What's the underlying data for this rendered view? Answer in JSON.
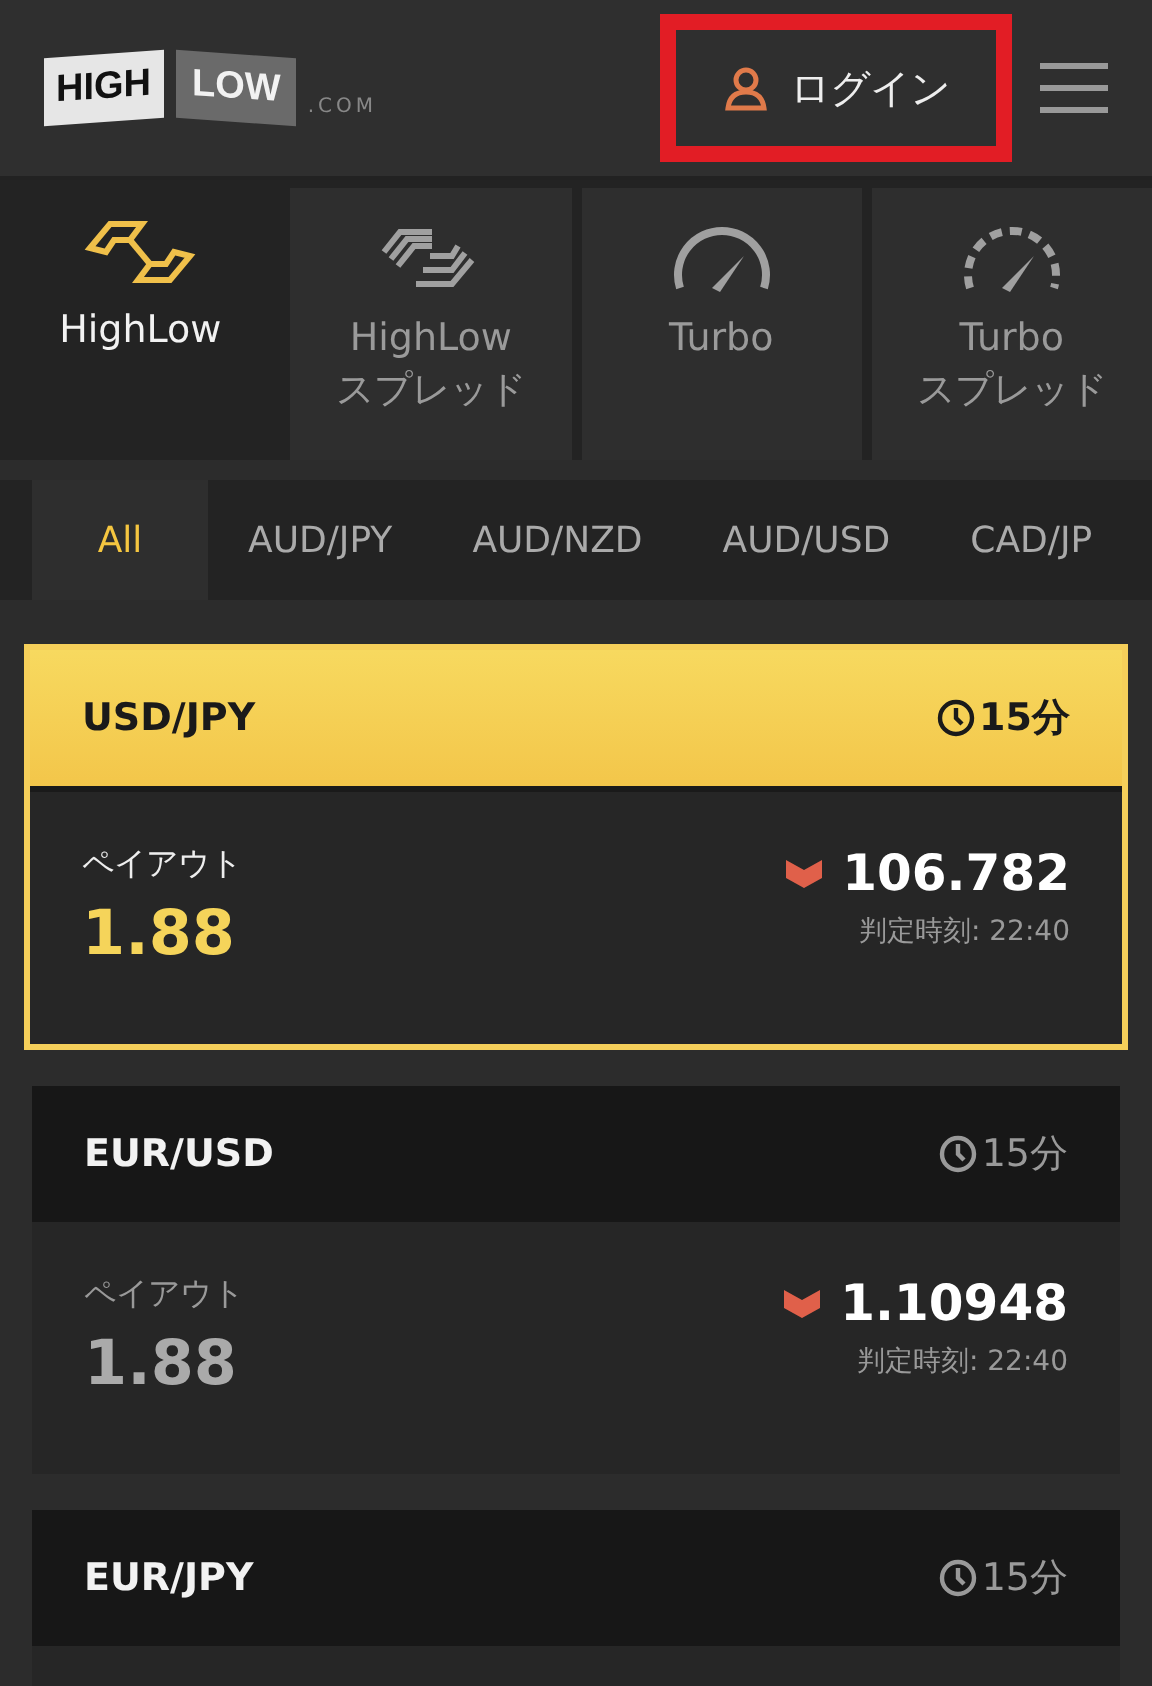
{
  "header": {
    "logo": {
      "high": "HIGH",
      "low": "LOW",
      "suffix": ".COM"
    },
    "login": {
      "label": "ログイン",
      "highlighted": true
    }
  },
  "products": [
    {
      "kind": "highlow",
      "label": "HighLow",
      "selected": true
    },
    {
      "kind": "spread",
      "label": "HighLow\nスプレッド",
      "selected": false
    },
    {
      "kind": "turbo",
      "label": "Turbo",
      "selected": false
    },
    {
      "kind": "turbo-spread",
      "label": "Turbo\nスプレッド",
      "selected": false
    }
  ],
  "currency_tabs": [
    {
      "label": "All",
      "selected": true
    },
    {
      "label": "AUD/JPY",
      "selected": false
    },
    {
      "label": "AUD/NZD",
      "selected": false
    },
    {
      "label": "AUD/USD",
      "selected": false
    },
    {
      "label": "CAD/JP",
      "selected": false
    }
  ],
  "assets": [
    {
      "pair": "USD/JPY",
      "duration": "15分",
      "selected": true,
      "payout_label": "ペイアウト",
      "payout": "1.88",
      "falling": true,
      "rate": "106.782",
      "expiry": "判定時刻: 22:40"
    },
    {
      "pair": "EUR/USD",
      "duration": "15分",
      "selected": false,
      "payout_label": "ペイアウト",
      "payout": "1.88",
      "falling": true,
      "rate": "1.10948",
      "expiry": "判定時刻: 22:40"
    },
    {
      "pair": "EUR/JPY",
      "duration": "15分",
      "selected": false
    }
  ]
}
